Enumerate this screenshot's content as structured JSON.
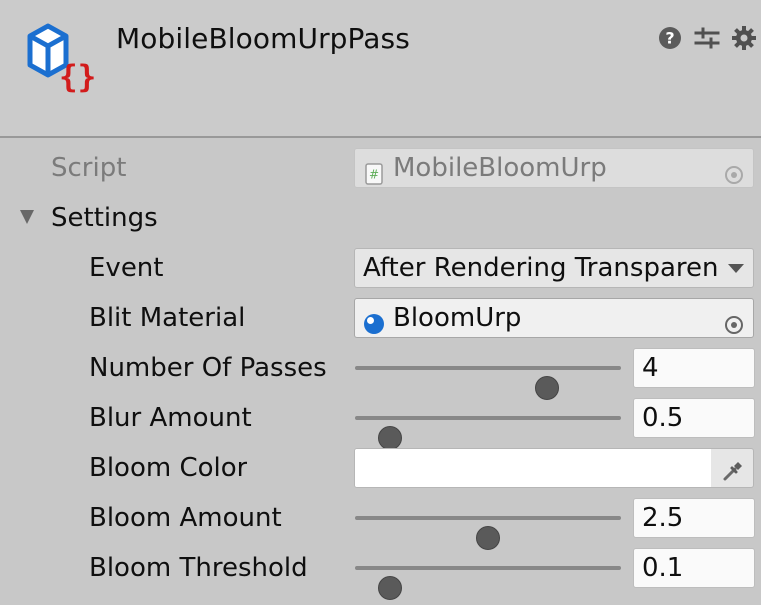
{
  "component": {
    "title": "MobileBloomUrpPass",
    "icon": "script-component-icon",
    "tools": [
      "help-icon",
      "preset-icon",
      "gear-icon"
    ]
  },
  "fields": {
    "script": {
      "label": "Script",
      "value": "MobileBloomUrp"
    },
    "settings": {
      "label": "Settings",
      "expanded": true
    },
    "event": {
      "label": "Event",
      "value": "After Rendering Transparents"
    },
    "blit_material": {
      "label": "Blit Material",
      "value": "BloomUrp"
    },
    "number_of_passes": {
      "label": "Number Of Passes",
      "value": "4",
      "slider_fraction": 0.72
    },
    "blur_amount": {
      "label": "Blur Amount",
      "value": "0.5",
      "slider_fraction": 0.13
    },
    "bloom_color": {
      "label": "Bloom Color",
      "value_color": "#ffffff"
    },
    "bloom_amount": {
      "label": "Bloom Amount",
      "value": "2.5",
      "slider_fraction": 0.5
    },
    "bloom_threshold": {
      "label": "Bloom Threshold",
      "value": "0.1",
      "slider_fraction": 0.13
    }
  },
  "colors": {
    "panel_background": "#c8c8c8",
    "header_background": "#cbcbcb",
    "accent_blue": "#1b6fd0",
    "script_icon_red": "#d21b1b"
  }
}
